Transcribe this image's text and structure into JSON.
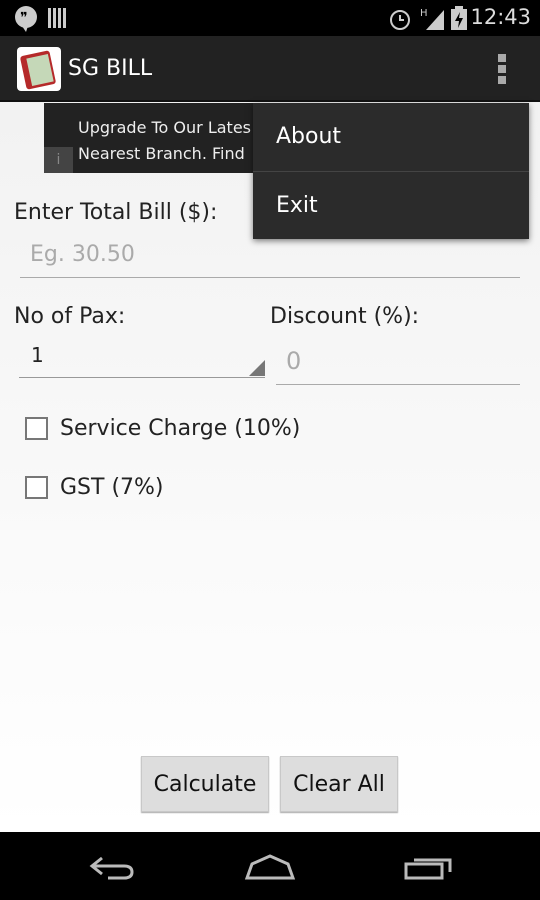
{
  "status_bar": {
    "time": "12:43",
    "icons": [
      "hangouts-icon",
      "barcode-icon",
      "alarm-icon",
      "signal-icon",
      "battery-charging-icon"
    ]
  },
  "action_bar": {
    "title": "SG BILL",
    "logo_text": "SG BILL"
  },
  "ad": {
    "line1": "Upgrade To Our Lates",
    "line2": "Nearest Branch. Find",
    "info": "i"
  },
  "menu": {
    "items": [
      {
        "label": "About"
      },
      {
        "label": "Exit"
      }
    ]
  },
  "form": {
    "total_label": "Enter Total Bill ($):",
    "total_placeholder": "Eg. 30.50",
    "pax_label": "No of Pax:",
    "pax_value": "1",
    "discount_label": "Discount (%):",
    "discount_placeholder": "0",
    "service_label": "Service Charge (10%)",
    "service_checked": false,
    "gst_label": "GST (7%)",
    "gst_checked": false
  },
  "buttons": {
    "calculate": "Calculate",
    "clear": "Clear All"
  }
}
